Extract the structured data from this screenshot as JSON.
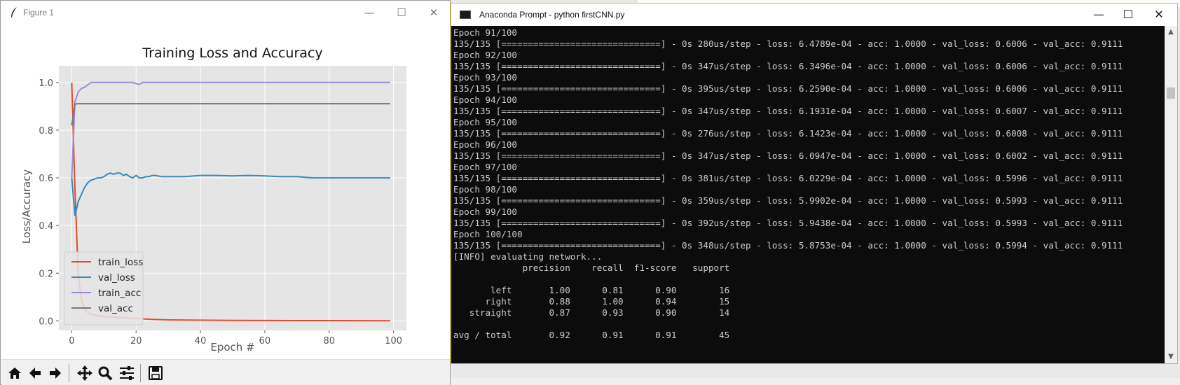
{
  "figure_window": {
    "title": "Figure 1",
    "minimize": "—",
    "maximize": "☐",
    "close": "✕"
  },
  "chart_data": {
    "type": "line",
    "title": "Training Loss and Accuracy",
    "xlabel": "Epoch #",
    "ylabel": "Loss/Accuracy",
    "xlim": [
      -4,
      104
    ],
    "ylim": [
      -0.04,
      1.07
    ],
    "xticks": [
      "0",
      "20",
      "40",
      "60",
      "80",
      "100"
    ],
    "yticks": [
      "0.0",
      "0.2",
      "0.4",
      "0.6",
      "0.8",
      "1.0"
    ],
    "grid": true,
    "legend": "lower-left",
    "series": [
      {
        "name": "train_loss",
        "color": "#e24a33",
        "x": [
          0,
          1,
          2,
          3,
          4,
          5,
          6,
          8,
          10,
          12,
          15,
          20,
          25,
          30,
          40,
          50,
          60,
          70,
          80,
          90,
          99
        ],
        "y": [
          1.0,
          0.55,
          0.2,
          0.09,
          0.05,
          0.035,
          0.028,
          0.022,
          0.018,
          0.016,
          0.014,
          0.01,
          0.006,
          0.004,
          0.003,
          0.002,
          0.0015,
          0.001,
          0.001,
          0.0008,
          0.0006
        ]
      },
      {
        "name": "val_loss",
        "color": "#348abd",
        "x": [
          0,
          1,
          2,
          3,
          4,
          5,
          6,
          7,
          8,
          9,
          10,
          11,
          12,
          13,
          14,
          15,
          16,
          17,
          18,
          19,
          20,
          21,
          22,
          23,
          24,
          25,
          26,
          28,
          30,
          35,
          40,
          45,
          50,
          55,
          60,
          65,
          70,
          75,
          80,
          85,
          90,
          95,
          99
        ],
        "y": [
          0.6,
          0.44,
          0.5,
          0.53,
          0.56,
          0.58,
          0.59,
          0.595,
          0.6,
          0.6,
          0.605,
          0.615,
          0.62,
          0.615,
          0.62,
          0.62,
          0.61,
          0.615,
          0.605,
          0.6,
          0.61,
          0.6,
          0.6,
          0.605,
          0.605,
          0.61,
          0.61,
          0.605,
          0.605,
          0.605,
          0.61,
          0.61,
          0.608,
          0.61,
          0.608,
          0.605,
          0.605,
          0.6,
          0.6,
          0.6,
          0.6,
          0.6,
          0.6
        ]
      },
      {
        "name": "train_acc",
        "color": "#988ed5",
        "x": [
          0,
          1,
          2,
          3,
          4,
          5,
          6,
          8,
          10,
          15,
          19,
          20,
          21,
          22,
          23,
          30,
          40,
          50,
          60,
          70,
          80,
          90,
          99
        ],
        "y": [
          0.6,
          0.92,
          0.96,
          0.975,
          0.98,
          0.99,
          1.0,
          1.0,
          1.0,
          1.0,
          1.0,
          0.995,
          0.992,
          1.0,
          1.0,
          1.0,
          1.0,
          1.0,
          1.0,
          1.0,
          1.0,
          1.0,
          1.0
        ]
      },
      {
        "name": "val_acc",
        "color": "#777777",
        "x": [
          0,
          1,
          2,
          3,
          5,
          10,
          20,
          40,
          60,
          80,
          99
        ],
        "y": [
          0.82,
          0.91,
          0.911,
          0.911,
          0.911,
          0.911,
          0.911,
          0.911,
          0.911,
          0.911,
          0.911
        ]
      }
    ]
  },
  "toolbar": {
    "home": "home-icon",
    "back": "back-arrow-icon",
    "forward": "forward-arrow-icon",
    "pan": "pan-icon",
    "zoom": "zoom-icon",
    "configure": "configure-subplots-icon",
    "save": "save-icon"
  },
  "console_window": {
    "title": "Anaconda Prompt - python  firstCNN.py",
    "minimize": "—",
    "maximize": "☐",
    "close": "✕",
    "lines": [
      "Epoch 91/100",
      "135/135 [==============================] - 0s 280us/step - loss: 6.4789e-04 - acc: 1.0000 - val_loss: 0.6006 - val_acc: 0.9111",
      "Epoch 92/100",
      "135/135 [==============================] - 0s 347us/step - loss: 6.3496e-04 - acc: 1.0000 - val_loss: 0.6006 - val_acc: 0.9111",
      "Epoch 93/100",
      "135/135 [==============================] - 0s 395us/step - loss: 6.2590e-04 - acc: 1.0000 - val_loss: 0.6006 - val_acc: 0.9111",
      "Epoch 94/100",
      "135/135 [==============================] - 0s 347us/step - loss: 6.1931e-04 - acc: 1.0000 - val_loss: 0.6007 - val_acc: 0.9111",
      "Epoch 95/100",
      "135/135 [==============================] - 0s 276us/step - loss: 6.1423e-04 - acc: 1.0000 - val_loss: 0.6008 - val_acc: 0.9111",
      "Epoch 96/100",
      "135/135 [==============================] - 0s 347us/step - loss: 6.0947e-04 - acc: 1.0000 - val_loss: 0.6002 - val_acc: 0.9111",
      "Epoch 97/100",
      "135/135 [==============================] - 0s 381us/step - loss: 6.0229e-04 - acc: 1.0000 - val_loss: 0.5996 - val_acc: 0.9111",
      "Epoch 98/100",
      "135/135 [==============================] - 0s 359us/step - loss: 5.9902e-04 - acc: 1.0000 - val_loss: 0.5993 - val_acc: 0.9111",
      "Epoch 99/100",
      "135/135 [==============================] - 0s 392us/step - loss: 5.9438e-04 - acc: 1.0000 - val_loss: 0.5993 - val_acc: 0.9111",
      "Epoch 100/100",
      "135/135 [==============================] - 0s 348us/step - loss: 5.8753e-04 - acc: 1.0000 - val_loss: 0.5994 - val_acc: 0.9111",
      "[INFO] evaluating network...",
      "             precision    recall  f1-score   support",
      "",
      "       left       1.00      0.81      0.90        16",
      "      right       0.88      1.00      0.94        15",
      "   straight       0.87      0.93      0.90        14",
      "",
      "avg / total       0.92      0.91      0.91        45"
    ]
  }
}
